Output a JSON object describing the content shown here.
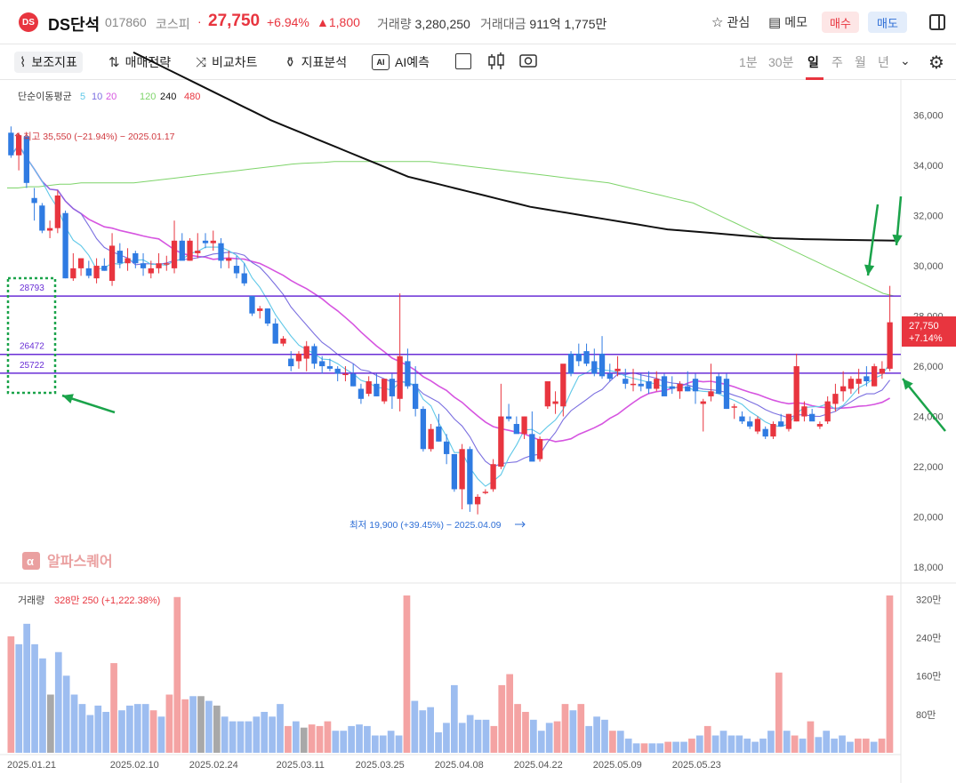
{
  "header": {
    "logo_text": "DS",
    "name": "DS단석",
    "code": "017860",
    "market": "코스피",
    "dot": "·",
    "price": "27,750",
    "change_pct": "+6.94%",
    "change_abs": "▲1,800",
    "volume_label": "거래량",
    "volume_value": "3,280,250",
    "amount_label": "거래대금",
    "amount_value": "911억 1,775만",
    "watch_label": "관심",
    "memo_label": "메모",
    "buy_label": "매수",
    "sell_label": "매도"
  },
  "toolbar": {
    "indicators": "보조지표",
    "strategy": "매매전략",
    "compare": "비교차트",
    "analysis": "지표분석",
    "ai_box": "AI",
    "ai_predict": "AI예측",
    "periods": [
      "1분",
      "30분",
      "일",
      "주",
      "월",
      "년"
    ],
    "active_period": "일"
  },
  "colors": {
    "up": "#e8353f",
    "down": "#2f7be2",
    "ma5": "#5fc8e8",
    "ma10": "#7b6fe0",
    "ma20": "#d655e0",
    "ma120": "#7ed46a",
    "ma240": "#111111",
    "ma480": "#e8353f",
    "level_line": "#6a2fd6",
    "annotation_box": "#1aa34a",
    "arrow": "#1aa34a",
    "volume_up": "#f4a3a3",
    "volume_down": "#9dbdf0",
    "volume_flat": "#a8a8a8"
  },
  "watermark": {
    "icon": "α",
    "text": "알파스퀘어"
  },
  "chart_data": {
    "type": "candlestick",
    "legend": {
      "title": "단순이동평균",
      "periods": [
        "5",
        "10",
        "20",
        "120",
        "240",
        "480"
      ]
    },
    "y_axis": {
      "ylim": [
        17400,
        37400
      ],
      "ticks": [
        "36,000",
        "34,000",
        "32,000",
        "30,000",
        "28,000",
        "26,000",
        "24,000",
        "22,000",
        "20,000",
        "18,000"
      ],
      "tick_values": [
        36000,
        34000,
        32000,
        30000,
        28000,
        26000,
        24000,
        22000,
        20000,
        18000
      ]
    },
    "x_axis": {
      "dates": [
        "2025.01.21",
        "2025.02.10",
        "2025.02.24",
        "2025.03.11",
        "2025.03.25",
        "2025.04.08",
        "2025.04.22",
        "2025.05.09",
        "2025.05.23"
      ],
      "date_indices": [
        0,
        13,
        23,
        34,
        44,
        54,
        64,
        74,
        84
      ]
    },
    "annotations": {
      "high": "최고 35,550 (−21.94%) − 2025.01.17",
      "low": "최저 19,900 (+39.45%) − 2025.04.09",
      "price_tag": "27,750",
      "price_tag_pct": "+7.14%",
      "levels": [
        {
          "label": "28793",
          "value": 28793
        },
        {
          "label": "26472",
          "value": 26472
        },
        {
          "label": "25722",
          "value": 25722
        }
      ]
    },
    "candles": [
      [
        35300,
        35550,
        34300,
        34400
      ],
      [
        34400,
        35300,
        33800,
        35200
      ],
      [
        35150,
        35200,
        33100,
        33300
      ],
      [
        32700,
        33100,
        31800,
        32500
      ],
      [
        32400,
        32500,
        31300,
        31400
      ],
      [
        31400,
        31800,
        31100,
        31500
      ],
      [
        31500,
        33000,
        31300,
        32800
      ],
      [
        32100,
        32200,
        29500,
        29500
      ],
      [
        29500,
        30500,
        29400,
        29900
      ],
      [
        29900,
        30300,
        29600,
        30300
      ],
      [
        29900,
        30200,
        29500,
        29600
      ],
      [
        29500,
        30300,
        29300,
        30000
      ],
      [
        30000,
        30300,
        29800,
        29800
      ],
      [
        29400,
        31300,
        29200,
        30800
      ],
      [
        30600,
        30900,
        29900,
        30100
      ],
      [
        30100,
        30700,
        29800,
        30300
      ],
      [
        30500,
        30600,
        29900,
        30100
      ],
      [
        30100,
        30500,
        29600,
        29900
      ],
      [
        29700,
        30200,
        29500,
        29900
      ],
      [
        29900,
        30500,
        29700,
        30100
      ],
      [
        30100,
        30400,
        29800,
        30100
      ],
      [
        29900,
        31800,
        29700,
        31000
      ],
      [
        31000,
        31300,
        30300,
        30200
      ],
      [
        30200,
        31100,
        30200,
        31000
      ],
      [
        30500,
        31300,
        30300,
        30600
      ],
      [
        31000,
        31300,
        30700,
        30900
      ],
      [
        30900,
        31400,
        30600,
        31000
      ],
      [
        30900,
        31100,
        29900,
        30200
      ],
      [
        30200,
        30600,
        29900,
        30300
      ],
      [
        30000,
        30400,
        29500,
        29700
      ],
      [
        29700,
        30100,
        29200,
        29300
      ],
      [
        28800,
        28800,
        28000,
        28100
      ],
      [
        28200,
        28400,
        27900,
        28300
      ],
      [
        28300,
        28300,
        27600,
        27700
      ],
      [
        27700,
        27900,
        26900,
        26900
      ],
      [
        26900,
        27200,
        26800,
        27100
      ],
      [
        26300,
        26600,
        25800,
        26000
      ],
      [
        26200,
        26600,
        25900,
        26500
      ],
      [
        26300,
        27000,
        25800,
        26800
      ],
      [
        26800,
        26900,
        25900,
        26100
      ],
      [
        26200,
        26400,
        25700,
        26000
      ],
      [
        26000,
        26300,
        25800,
        25900
      ],
      [
        25900,
        26000,
        25400,
        25700
      ],
      [
        25700,
        26000,
        25400,
        25700
      ],
      [
        25700,
        26100,
        25200,
        25200
      ],
      [
        25100,
        25300,
        24500,
        24700
      ],
      [
        24900,
        25600,
        24800,
        25400
      ],
      [
        25300,
        25700,
        24800,
        24800
      ],
      [
        24600,
        25400,
        24500,
        25500
      ],
      [
        25500,
        25700,
        24300,
        24800
      ],
      [
        24700,
        28900,
        24200,
        26400
      ],
      [
        26200,
        26700,
        25100,
        25200
      ],
      [
        25300,
        26000,
        24000,
        24300
      ],
      [
        24300,
        24400,
        22600,
        22700
      ],
      [
        22700,
        23700,
        22600,
        23500
      ],
      [
        23600,
        24100,
        23000,
        23000
      ],
      [
        23000,
        23300,
        22100,
        22500
      ],
      [
        22500,
        22500,
        21000,
        21100
      ],
      [
        21100,
        22900,
        20300,
        22700
      ],
      [
        22700,
        22800,
        20200,
        20500
      ],
      [
        20500,
        20900,
        20100,
        20800
      ],
      [
        21000,
        21100,
        20900,
        21000
      ],
      [
        21100,
        22300,
        21000,
        22100
      ],
      [
        22000,
        25300,
        21900,
        24000
      ],
      [
        24000,
        24500,
        23800,
        23900
      ],
      [
        23700,
        24000,
        23400,
        23300
      ],
      [
        23300,
        24000,
        23100,
        24000
      ],
      [
        23300,
        24200,
        22900,
        22200
      ],
      [
        22300,
        23200,
        22200,
        23100
      ],
      [
        24400,
        25400,
        24300,
        25400
      ],
      [
        24500,
        25000,
        24100,
        24600
      ],
      [
        24400,
        25500,
        24000,
        26100
      ],
      [
        26500,
        26600,
        25600,
        25700
      ],
      [
        26500,
        26900,
        26000,
        26200
      ],
      [
        26600,
        26900,
        26000,
        26100
      ],
      [
        26200,
        26700,
        25600,
        25700
      ],
      [
        26500,
        27200,
        25500,
        25600
      ],
      [
        25700,
        26100,
        25400,
        25500
      ],
      [
        25800,
        26400,
        25600,
        25900
      ],
      [
        25500,
        25900,
        25100,
        25300
      ],
      [
        25300,
        25900,
        25000,
        25300
      ],
      [
        25300,
        25700,
        25000,
        25200
      ],
      [
        25400,
        25800,
        24900,
        25100
      ],
      [
        25100,
        25800,
        25000,
        25500
      ],
      [
        25600,
        25700,
        25300,
        24800
      ],
      [
        25200,
        25600,
        24900,
        25100
      ],
      [
        25000,
        25400,
        24700,
        25300
      ],
      [
        25200,
        25800,
        25000,
        25000
      ],
      [
        25500,
        25700,
        24500,
        25000
      ],
      [
        24500,
        24700,
        23400,
        24600
      ],
      [
        24800,
        26100,
        24600,
        25000
      ],
      [
        25600,
        25700,
        24900,
        24900
      ],
      [
        25500,
        25700,
        24300,
        24300
      ],
      [
        24400,
        24500,
        23900,
        24400
      ],
      [
        24000,
        24200,
        23700,
        23800
      ],
      [
        23800,
        24000,
        23500,
        23600
      ],
      [
        23400,
        24000,
        23300,
        23900
      ],
      [
        23500,
        23600,
        23100,
        23200
      ],
      [
        23200,
        23800,
        23100,
        23700
      ],
      [
        23800,
        24100,
        23600,
        23600
      ],
      [
        23500,
        24100,
        23400,
        24100
      ],
      [
        23800,
        26500,
        23800,
        26000
      ],
      [
        24000,
        24600,
        23800,
        24400
      ],
      [
        24100,
        24300,
        23900,
        23800
      ],
      [
        23600,
        23800,
        23500,
        23700
      ],
      [
        23800,
        24800,
        23700,
        24600
      ],
      [
        24500,
        25300,
        24200,
        24900
      ],
      [
        25000,
        25800,
        24600,
        25200
      ],
      [
        25100,
        25600,
        24900,
        25500
      ],
      [
        25300,
        25900,
        24900,
        25500
      ],
      [
        25600,
        26000,
        25200,
        25400
      ],
      [
        25200,
        26100,
        25200,
        26000
      ],
      [
        25700,
        26200,
        25500,
        25900
      ],
      [
        25900,
        29200,
        25800,
        27750
      ]
    ],
    "ma120": [
      33100,
      33100,
      33150,
      33150,
      33200,
      33250,
      33250,
      33300,
      33300,
      33300,
      33300,
      33300,
      33300,
      33350,
      33400,
      33450,
      33500,
      33550,
      33600,
      33650,
      33700,
      33750,
      33800,
      33850,
      33900,
      33950,
      34000,
      34050,
      34080,
      34100,
      34120,
      34150,
      34150,
      34150,
      34150,
      34150,
      34150,
      34150,
      34150,
      34150,
      34150,
      34100,
      34050,
      34000,
      33950,
      33900,
      33850,
      33800,
      33750,
      33700,
      33650,
      33600,
      33550,
      33500,
      33450,
      33400,
      33350,
      33300,
      33200,
      33100,
      33000,
      32900,
      32800,
      32700,
      32600,
      32500,
      32300,
      32100,
      31900,
      31700,
      31500,
      31300,
      31100,
      30900,
      30700,
      30500,
      30300,
      30100,
      29900,
      29700,
      29500,
      29300,
      29100,
      28900,
      28800
    ],
    "ma240": [
      38500,
      38200,
      37900,
      37600,
      37300,
      37000,
      36700,
      36400,
      36100,
      35800,
      35550,
      35300,
      35050,
      34800,
      34550,
      34300,
      34050,
      33800,
      33550,
      33400,
      33250,
      33100,
      32950,
      32800,
      32650,
      32500,
      32350,
      32250,
      32150,
      32050,
      31950,
      31850,
      31750,
      31650,
      31550,
      31450,
      31400,
      31350,
      31300,
      31250,
      31200,
      31150,
      31100,
      31080,
      31060,
      31050,
      31040,
      31030,
      31020,
      31010,
      31000
    ],
    "volumes": [
      [
        0.74,
        "u"
      ],
      [
        0.69,
        "d"
      ],
      [
        0.82,
        "d"
      ],
      [
        0.69,
        "d"
      ],
      [
        0.6,
        "d"
      ],
      [
        0.37,
        "f"
      ],
      [
        0.64,
        "d"
      ],
      [
        0.49,
        "d"
      ],
      [
        0.37,
        "d"
      ],
      [
        0.31,
        "d"
      ],
      [
        0.24,
        "d"
      ],
      [
        0.3,
        "d"
      ],
      [
        0.26,
        "d"
      ],
      [
        0.57,
        "u"
      ],
      [
        0.27,
        "d"
      ],
      [
        0.3,
        "d"
      ],
      [
        0.31,
        "d"
      ],
      [
        0.31,
        "d"
      ],
      [
        0.27,
        "u"
      ],
      [
        0.23,
        "d"
      ],
      [
        0.37,
        "u"
      ],
      [
        0.99,
        "u"
      ],
      [
        0.34,
        "u"
      ],
      [
        0.36,
        "d"
      ],
      [
        0.36,
        "f"
      ],
      [
        0.33,
        "d"
      ],
      [
        0.3,
        "f"
      ],
      [
        0.23,
        "d"
      ],
      [
        0.2,
        "d"
      ],
      [
        0.2,
        "d"
      ],
      [
        0.2,
        "d"
      ],
      [
        0.23,
        "d"
      ],
      [
        0.26,
        "d"
      ],
      [
        0.23,
        "d"
      ],
      [
        0.31,
        "d"
      ],
      [
        0.17,
        "u"
      ],
      [
        0.2,
        "d"
      ],
      [
        0.16,
        "f"
      ],
      [
        0.18,
        "u"
      ],
      [
        0.17,
        "u"
      ],
      [
        0.2,
        "u"
      ],
      [
        0.14,
        "d"
      ],
      [
        0.14,
        "d"
      ],
      [
        0.17,
        "d"
      ],
      [
        0.18,
        "d"
      ],
      [
        0.17,
        "d"
      ],
      [
        0.11,
        "d"
      ],
      [
        0.11,
        "d"
      ],
      [
        0.14,
        "d"
      ],
      [
        0.11,
        "d"
      ],
      [
        1.0,
        "u"
      ],
      [
        0.33,
        "d"
      ],
      [
        0.27,
        "d"
      ],
      [
        0.29,
        "d"
      ],
      [
        0.13,
        "d"
      ],
      [
        0.19,
        "d"
      ],
      [
        0.43,
        "d"
      ],
      [
        0.19,
        "d"
      ],
      [
        0.24,
        "d"
      ],
      [
        0.21,
        "d"
      ],
      [
        0.21,
        "d"
      ],
      [
        0.17,
        "u"
      ],
      [
        0.43,
        "u"
      ],
      [
        0.5,
        "u"
      ],
      [
        0.31,
        "u"
      ],
      [
        0.26,
        "u"
      ],
      [
        0.21,
        "d"
      ],
      [
        0.14,
        "d"
      ],
      [
        0.19,
        "d"
      ],
      [
        0.2,
        "u"
      ],
      [
        0.31,
        "u"
      ],
      [
        0.27,
        "d"
      ],
      [
        0.31,
        "u"
      ],
      [
        0.17,
        "d"
      ],
      [
        0.23,
        "d"
      ],
      [
        0.21,
        "d"
      ],
      [
        0.14,
        "u"
      ],
      [
        0.14,
        "d"
      ],
      [
        0.09,
        "d"
      ],
      [
        0.06,
        "d"
      ],
      [
        0.06,
        "u"
      ],
      [
        0.06,
        "d"
      ],
      [
        0.06,
        "d"
      ],
      [
        0.07,
        "u"
      ],
      [
        0.07,
        "d"
      ],
      [
        0.07,
        "d"
      ],
      [
        0.09,
        "u"
      ],
      [
        0.11,
        "d"
      ],
      [
        0.17,
        "u"
      ],
      [
        0.11,
        "d"
      ],
      [
        0.14,
        "d"
      ],
      [
        0.11,
        "d"
      ],
      [
        0.11,
        "d"
      ],
      [
        0.09,
        "d"
      ],
      [
        0.07,
        "d"
      ],
      [
        0.09,
        "d"
      ],
      [
        0.14,
        "d"
      ],
      [
        0.51,
        "u"
      ],
      [
        0.14,
        "d"
      ],
      [
        0.11,
        "u"
      ],
      [
        0.09,
        "d"
      ],
      [
        0.2,
        "u"
      ],
      [
        0.1,
        "d"
      ],
      [
        0.14,
        "d"
      ],
      [
        0.09,
        "d"
      ],
      [
        0.11,
        "d"
      ],
      [
        0.07,
        "d"
      ],
      [
        0.09,
        "u"
      ],
      [
        0.09,
        "u"
      ],
      [
        0.07,
        "d"
      ],
      [
        0.09,
        "u"
      ],
      [
        1.0,
        "u"
      ]
    ],
    "volume_legend": {
      "label": "거래량",
      "value": "328만 250 (+1,222.38%)"
    },
    "volume_axis": {
      "ticks": [
        "320만",
        "240만",
        "160만",
        "80만"
      ],
      "tick_values": [
        320,
        240,
        160,
        80
      ],
      "ymax": 328
    }
  }
}
